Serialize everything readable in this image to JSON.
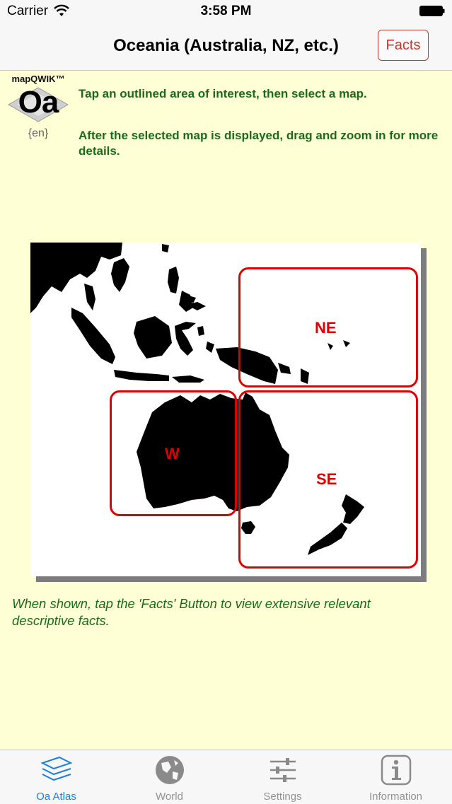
{
  "status_bar": {
    "carrier": "Carrier",
    "time": "3:58 PM"
  },
  "nav": {
    "title": "Oceania (Australia, NZ, etc.)",
    "facts_label": "Facts"
  },
  "logo": {
    "brand": "mapQWIK™",
    "code": "Oa",
    "lang": "{en}"
  },
  "instructions": {
    "line1": "Tap an outlined area of interest, then select a map.",
    "line2": "After the selected map is displayed, drag and zoom in for more details."
  },
  "map": {
    "regions": [
      {
        "id": "NE",
        "label": "NE"
      },
      {
        "id": "W",
        "label": "W"
      },
      {
        "id": "SE",
        "label": "SE"
      }
    ]
  },
  "hint": "When shown, tap the 'Facts' Button to view extensive relevant descriptive facts.",
  "tabs": [
    {
      "label": "Oa Atlas",
      "icon": "layers-icon",
      "active": true
    },
    {
      "label": "World",
      "icon": "globe-icon",
      "active": false
    },
    {
      "label": "Settings",
      "icon": "sliders-icon",
      "active": false
    },
    {
      "label": "Information",
      "icon": "info-icon",
      "active": false
    }
  ],
  "colors": {
    "accent": "#1e7fd9",
    "region": "#e00000",
    "instructions": "#1b6b1b",
    "background": "#ffffd6"
  }
}
